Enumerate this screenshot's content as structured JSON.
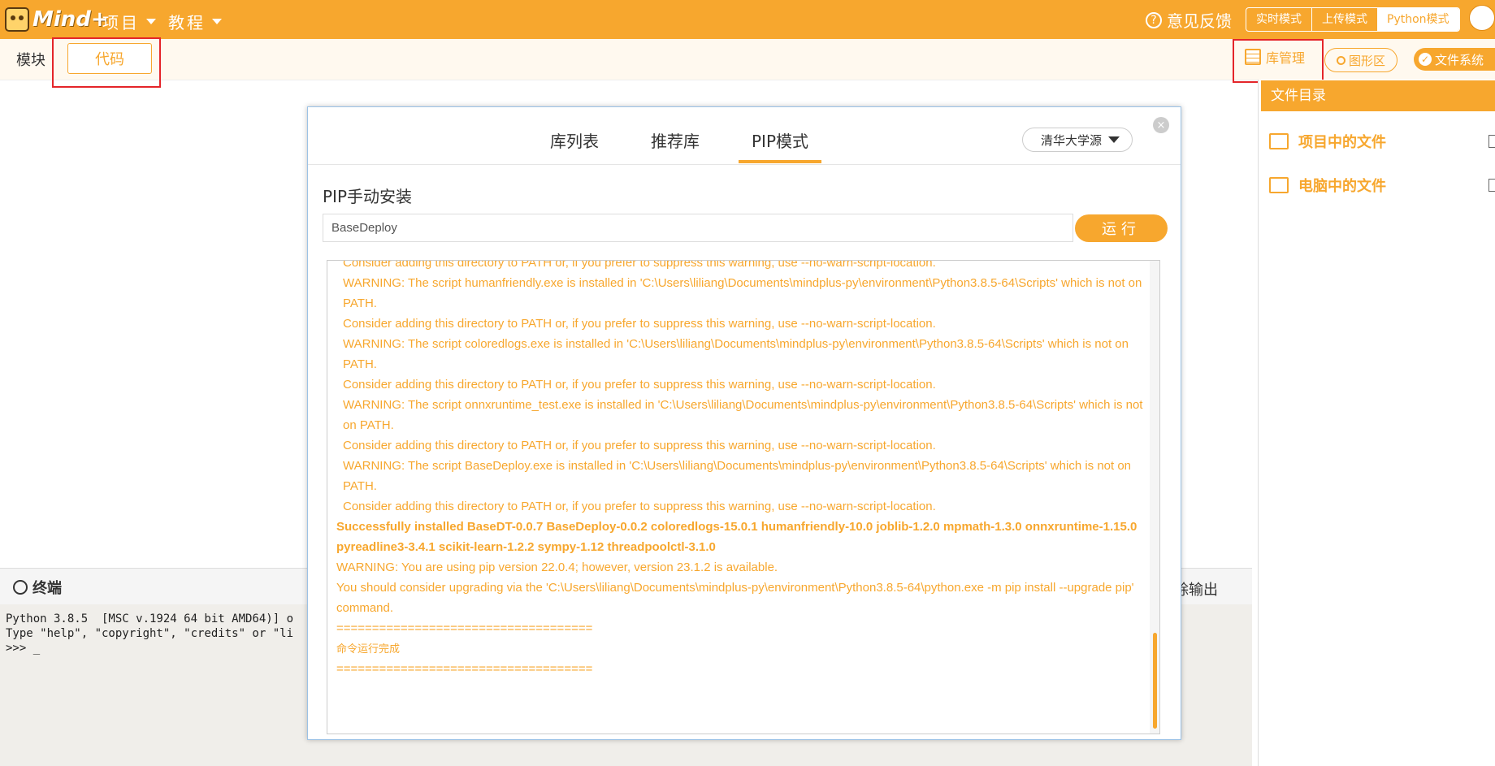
{
  "app": {
    "logo_text": "Mind+"
  },
  "topbar": {
    "menus": [
      {
        "label": "项目"
      },
      {
        "label": "教程"
      }
    ],
    "feedback_label": "意见反馈",
    "modes": [
      {
        "label": "实时模式"
      },
      {
        "label": "上传模式"
      },
      {
        "label": "Python模式",
        "active": true
      }
    ]
  },
  "subbar": {
    "tab_modules": "模块",
    "tab_code": "代码",
    "library_manager": "库管理",
    "graphic_area": "图形区",
    "file_system": "文件系统"
  },
  "right_panel": {
    "title": "文件目录",
    "items": [
      {
        "label": "项目中的文件"
      },
      {
        "label": "电脑中的文件"
      }
    ]
  },
  "terminal": {
    "title": "终端",
    "clear_output_partial": "除输出",
    "lines": [
      "Python 3.8.5  [MSC v.1924 64 bit AMD64)] o",
      "Type \"help\", \"copyright\", \"credits\" or \"li",
      ">>> _"
    ]
  },
  "modal": {
    "tabs": [
      {
        "label": "库列表"
      },
      {
        "label": "推荐库"
      },
      {
        "label": "PIP模式",
        "active": true
      }
    ],
    "source": "清华大学源",
    "close_glyph": "×",
    "pip_title": "PIP手动安装",
    "pip_input_value": "BaseDeploy",
    "run_label": "运行",
    "output_lines": [
      {
        "text": "Consider adding this directory to PATH or, if you prefer to suppress this warning, use --no-warn-script-location.",
        "style": "indent"
      },
      {
        "text": "WARNING: The script humanfriendly.exe is installed in 'C:\\Users\\liliang\\Documents\\mindplus-py\\environment\\Python3.8.5-64\\Scripts' which is not on PATH.",
        "style": "indent"
      },
      {
        "text": "Consider adding this directory to PATH or, if you prefer to suppress this warning, use --no-warn-script-location.",
        "style": "indent"
      },
      {
        "text": "WARNING: The script coloredlogs.exe is installed in 'C:\\Users\\liliang\\Documents\\mindplus-py\\environment\\Python3.8.5-64\\Scripts' which is not on PATH.",
        "style": "indent"
      },
      {
        "text": "Consider adding this directory to PATH or, if you prefer to suppress this warning, use --no-warn-script-location.",
        "style": "indent"
      },
      {
        "text": "WARNING: The script onnxruntime_test.exe is installed in 'C:\\Users\\liliang\\Documents\\mindplus-py\\environment\\Python3.8.5-64\\Scripts' which is not on PATH.",
        "style": "indent"
      },
      {
        "text": "Consider adding this directory to PATH or, if you prefer to suppress this warning, use --no-warn-script-location.",
        "style": "indent"
      },
      {
        "text": "WARNING: The script BaseDeploy.exe is installed in 'C:\\Users\\liliang\\Documents\\mindplus-py\\environment\\Python3.8.5-64\\Scripts' which is not on PATH.",
        "style": "indent"
      },
      {
        "text": "Consider adding this directory to PATH or, if you prefer to suppress this warning, use --no-warn-script-location.",
        "style": "indent"
      },
      {
        "text": "Successfully installed BaseDT-0.0.7 BaseDeploy-0.0.2 coloredlogs-15.0.1 humanfriendly-10.0 joblib-1.2.0 mpmath-1.3.0 onnxruntime-1.15.0 pyreadline3-3.4.1 scikit-learn-1.2.2 sympy-1.12 threadpoolctl-3.1.0",
        "style": "bold"
      },
      {
        "text": "WARNING: You are using pip version 22.0.4; however, version 23.1.2 is available.",
        "style": ""
      },
      {
        "text": "You should consider upgrading via the 'C:\\Users\\liliang\\Documents\\mindplus-py\\environment\\Python3.8.5-64\\python.exe -m pip install --upgrade pip' command.",
        "style": ""
      },
      {
        "text": " ====================================",
        "style": ""
      },
      {
        "text": "      命令运行完成",
        "style": "small"
      },
      {
        "text": "====================================",
        "style": ""
      }
    ]
  },
  "colors": {
    "accent": "#f7a72e",
    "highlight_box": "#e4252a"
  }
}
